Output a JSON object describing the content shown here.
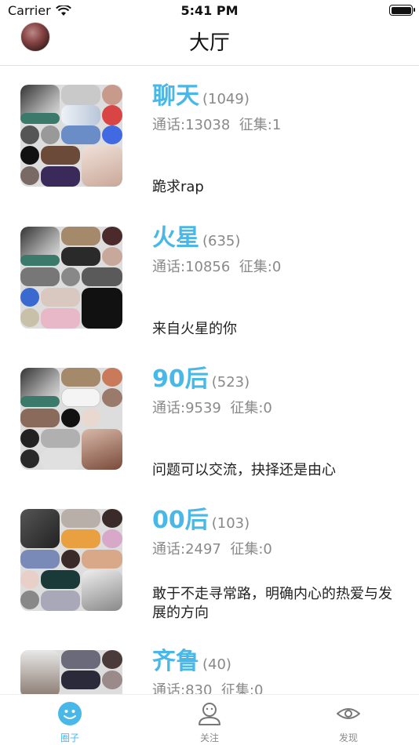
{
  "status_bar": {
    "carrier": "Carrier",
    "time": "5:41 PM"
  },
  "nav": {
    "title": "大厅"
  },
  "stats_labels": {
    "calls": "通话:",
    "collect": "征集:"
  },
  "groups": [
    {
      "name": "聊天",
      "count": "(1049)",
      "calls": "13038",
      "collect": "1",
      "desc": "跪求rap"
    },
    {
      "name": "火星",
      "count": "(635)",
      "calls": "10856",
      "collect": "0",
      "desc": "来自火星的你"
    },
    {
      "name": "90后",
      "count": "(523)",
      "calls": "9539",
      "collect": "0",
      "desc": "问题可以交流，抉择还是由心"
    },
    {
      "name": "00后",
      "count": "(103)",
      "calls": "2497",
      "collect": "0",
      "desc": "敢于不走寻常路，明确内心的热爱与发展的方向"
    },
    {
      "name": "齐鲁",
      "count": "(40)",
      "calls": "830",
      "collect": "0",
      "desc": ""
    }
  ],
  "tabs": [
    {
      "label": "圈子",
      "icon": "circle-face-icon",
      "active": true
    },
    {
      "label": "关注",
      "icon": "person-icon",
      "active": false
    },
    {
      "label": "发现",
      "icon": "eye-icon",
      "active": false
    }
  ],
  "colors": {
    "accent": "#49b8e9",
    "muted": "#8a8a8a",
    "divider": "#e2e2e2"
  }
}
